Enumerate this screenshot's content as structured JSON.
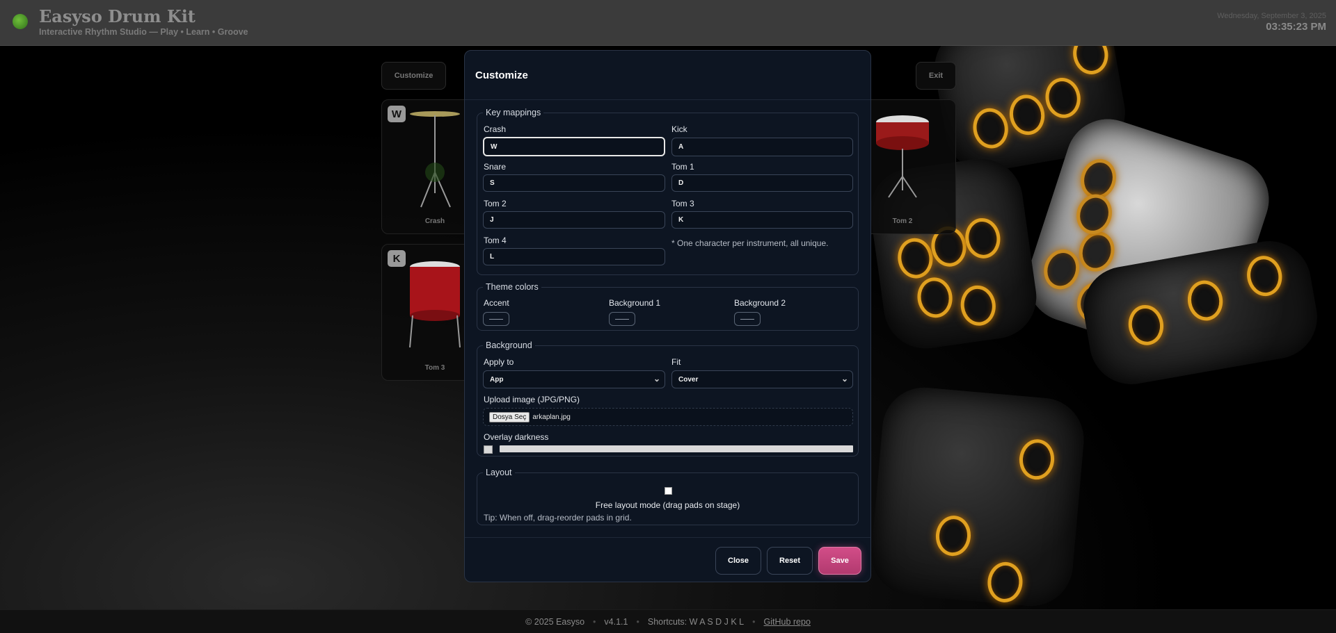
{
  "header": {
    "title": "Easyso Drum Kit",
    "subtitle": "Interactive Rhythm Studio — Play • Learn • Groove",
    "date": "Wednesday, September 3, 2025",
    "time": "03:35:23 PM"
  },
  "stage": {
    "customize_label": "Customize",
    "exit_label": "Exit",
    "pads": [
      {
        "key": "W",
        "name": "Crash"
      },
      {
        "key": "",
        "name": "Tom 2"
      },
      {
        "key": "K",
        "name": "Tom 3"
      }
    ]
  },
  "modal": {
    "title": "Customize",
    "key_mappings": {
      "legend": "Key mappings",
      "fields": [
        {
          "label": "Crash",
          "value": "W"
        },
        {
          "label": "Kick",
          "value": "A"
        },
        {
          "label": "Snare",
          "value": "S"
        },
        {
          "label": "Tom 1",
          "value": "D"
        },
        {
          "label": "Tom 2",
          "value": "J"
        },
        {
          "label": "Tom 3",
          "value": "K"
        },
        {
          "label": "Tom 4",
          "value": "L"
        }
      ],
      "note": "* One character per instrument, all unique."
    },
    "theme_colors": {
      "legend": "Theme colors",
      "accent_label": "Accent",
      "bg1_label": "Background 1",
      "bg2_label": "Background 2"
    },
    "background": {
      "legend": "Background",
      "apply_to_label": "Apply to",
      "apply_to_value": "App",
      "fit_label": "Fit",
      "fit_value": "Cover",
      "upload_label": "Upload image (JPG/PNG)",
      "file_button": "Dosya Seç",
      "file_name": "arkaplan.jpg",
      "overlay_label": "Overlay darkness",
      "overlay_value": 0
    },
    "layout": {
      "legend": "Layout",
      "free_layout_label": "Free layout mode (drag pads on stage)",
      "free_layout_checked": false,
      "tip": "Tip: When off, drag-reorder pads in grid."
    },
    "buttons": {
      "close": "Close",
      "reset": "Reset",
      "save": "Save"
    }
  },
  "footer": {
    "copyright": "© 2025 Easyso",
    "version": "v4.1.1",
    "shortcuts": "Shortcuts: W A S D J K L",
    "repo_link": "GitHub repo"
  },
  "colors": {
    "accent": "#d24d88",
    "modal_bg": "#0d1522",
    "pip": "#e0a020"
  }
}
